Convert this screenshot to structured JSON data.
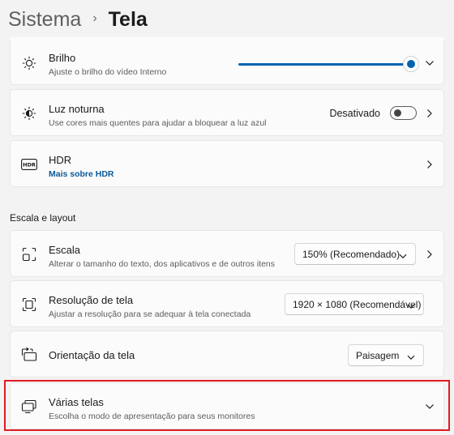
{
  "breadcrumb": {
    "parent": "Sistema",
    "separator": "›",
    "current": "Tela"
  },
  "brightness": {
    "title": "Brilho",
    "subtitle": "Ajuste o brilho do vídeo Interno",
    "level_percent": 100,
    "icon": "sun-icon"
  },
  "night_light": {
    "title": "Luz noturna",
    "subtitle": "Use cores mais quentes para ajudar a bloquear a luz azul",
    "toggle_label": "Desativado",
    "enabled": false,
    "icon": "half-sun-icon"
  },
  "hdr": {
    "title": "HDR",
    "link": "Mais sobre HDR",
    "icon_text": "HDR",
    "icon": "hdr-icon"
  },
  "section_scale_layout": {
    "label": "Escala e layout"
  },
  "scale": {
    "title": "Escala",
    "subtitle": "Alterar o tamanho do texto, dos aplicativos e de outros itens",
    "selected": "150% (Recomendado)",
    "icon": "scale-icon"
  },
  "resolution": {
    "title": "Resolução de tela",
    "subtitle": "Ajustar a resolução para se adequar à tela conectada",
    "selected": "1920 × 1080 (Recomendável)",
    "icon": "resolution-icon"
  },
  "orientation": {
    "title": "Orientação da tela",
    "selected": "Paisagem",
    "icon": "orientation-icon"
  },
  "multiple_displays": {
    "title": "Várias telas",
    "subtitle": "Escolha o modo de apresentação para seus monitores",
    "icon": "multiple-displays-icon"
  },
  "colors": {
    "accent": "#0063b1",
    "link": "#0b5a99",
    "highlight": "#e01b24",
    "background": "#f3f3f3",
    "card": "#fbfbfb"
  }
}
